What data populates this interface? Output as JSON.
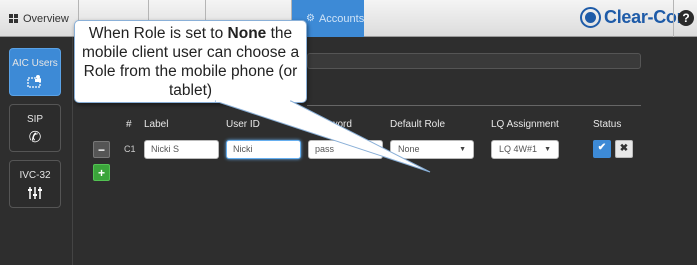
{
  "topbar": {
    "tabs": [
      {
        "label": "Overview"
      },
      {
        "label": ""
      },
      {
        "label": ""
      },
      {
        "label": ""
      },
      {
        "label": "Accounts"
      }
    ],
    "brand": "Clear-Com",
    "help": "?"
  },
  "sidebar": {
    "items": [
      {
        "label": "AIC Users",
        "icon": "id-card-icon",
        "active": true
      },
      {
        "label": "SIP",
        "icon": "phone-icon",
        "active": false
      },
      {
        "label": "IVC-32",
        "icon": "sliders-icon",
        "active": false
      }
    ]
  },
  "table": {
    "headers": [
      "#",
      "Label",
      "User ID",
      "Password",
      "Default Role",
      "LQ Assignment",
      "Status"
    ],
    "rows": [
      {
        "num": "C1",
        "label": "Nicki S",
        "user_id": "Nicki",
        "password": "pass",
        "role": "None",
        "lq": "LQ 4W#1"
      }
    ]
  },
  "callout": {
    "before": "When Role is set to ",
    "emph": "None",
    "after": " the mobile client user can choose a Role from the mobile phone (or tablet)"
  },
  "colors": {
    "accent": "#3d8ad6",
    "add": "#3ba53b",
    "background": "#2e2e2e",
    "brand": "#1e5ba8"
  }
}
